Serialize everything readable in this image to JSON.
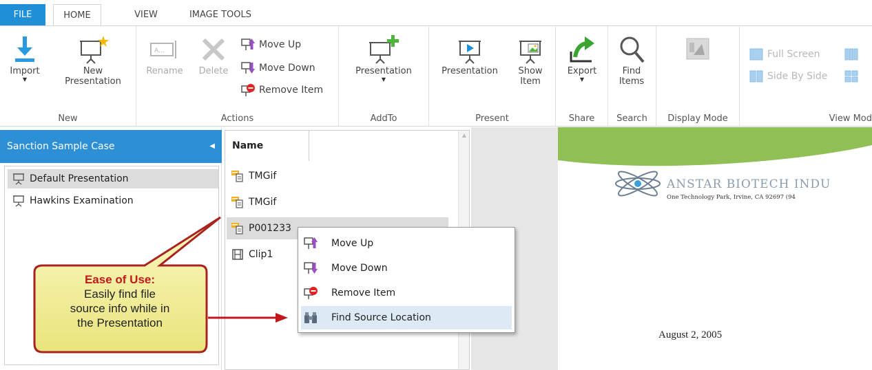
{
  "tabs": [
    {
      "label": "FILE"
    },
    {
      "label": "HOME"
    },
    {
      "label": "VIEW"
    },
    {
      "label": "IMAGE TOOLS"
    }
  ],
  "ribbon": {
    "groups": {
      "new": "New",
      "actions": "Actions",
      "addto": "AddTo",
      "present": "Present",
      "share": "Share",
      "search": "Search",
      "display_mode": "Display Mode",
      "view_mode": "View Mod"
    },
    "buttons": {
      "import": "Import",
      "new_presentation_1": "New",
      "new_presentation_2": "Presentation",
      "rename": "Rename",
      "delete": "Delete",
      "move_up": "Move Up",
      "move_down": "Move Down",
      "remove_item": "Remove Item",
      "addto_presentation": "Presentation",
      "present_presentation": "Presentation",
      "show_item_1": "Show",
      "show_item_2": "Item",
      "export": "Export",
      "find_items_1": "Find",
      "find_items_2": "Items",
      "full_screen": "Full Screen",
      "side_by_side": "Side By Side"
    }
  },
  "left_panel": {
    "case_title": "Sanction Sample Case",
    "items": [
      {
        "label": "Default Presentation",
        "selected": true
      },
      {
        "label": "Hawkins Examination",
        "selected": false
      }
    ]
  },
  "list": {
    "column_header": "Name",
    "rows": [
      {
        "label": "TMGif",
        "icon": "document-icon"
      },
      {
        "label": "TMGif",
        "icon": "document-icon"
      },
      {
        "label": "P001233",
        "icon": "document-icon"
      },
      {
        "label": "Clip1",
        "icon": "film-icon"
      }
    ]
  },
  "context_menu": {
    "items": [
      {
        "label": "Move Up"
      },
      {
        "label": "Move Down"
      },
      {
        "label": "Remove Item"
      },
      {
        "label": "Find Source Location"
      }
    ]
  },
  "preview": {
    "company_name": "ANSTAR BIOTECH INDU",
    "company_address": "One Technology Park, Irvine, CA 92697 (94",
    "date": "August 2, 2005"
  },
  "callout": {
    "title": "Ease of Use:",
    "body_1": "Easily find file",
    "body_2": "source info while in",
    "body_3": "the Presentation"
  },
  "colors": {
    "accent_blue": "#1f8fd8",
    "case_header_blue": "#2d8fd6",
    "callout_red": "#c0181b",
    "callout_yellow": "#f3f0a0",
    "preview_green": "#8fbf55"
  }
}
